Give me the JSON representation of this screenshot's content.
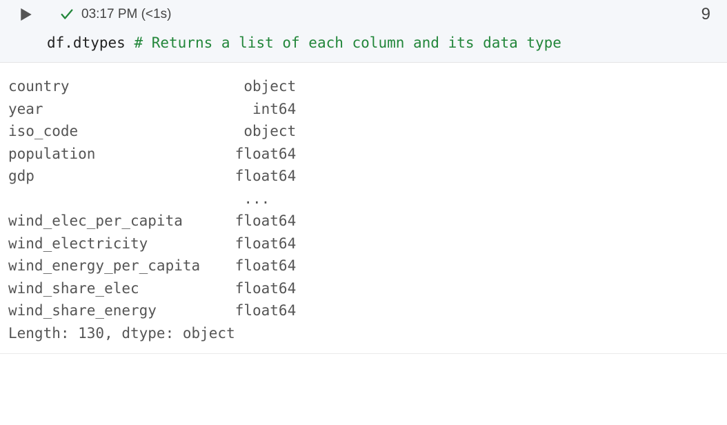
{
  "header": {
    "timestamp": "03:17 PM (<1s)",
    "exec_count": "9"
  },
  "code": {
    "identifier": "df.dtypes ",
    "comment": "# Returns a list of each column and its data type"
  },
  "output": {
    "rows": [
      {
        "name": "country",
        "dtype": "object"
      },
      {
        "name": "year",
        "dtype": "int64"
      },
      {
        "name": "iso_code",
        "dtype": "object"
      },
      {
        "name": "population",
        "dtype": "float64"
      },
      {
        "name": "gdp",
        "dtype": "float64"
      },
      {
        "name": "",
        "dtype": "...   "
      },
      {
        "name": "wind_elec_per_capita",
        "dtype": "float64"
      },
      {
        "name": "wind_electricity",
        "dtype": "float64"
      },
      {
        "name": "wind_energy_per_capita",
        "dtype": "float64"
      },
      {
        "name": "wind_share_elec",
        "dtype": "float64"
      },
      {
        "name": "wind_share_energy",
        "dtype": "float64"
      }
    ],
    "footer": "Length: 130, dtype: object"
  }
}
